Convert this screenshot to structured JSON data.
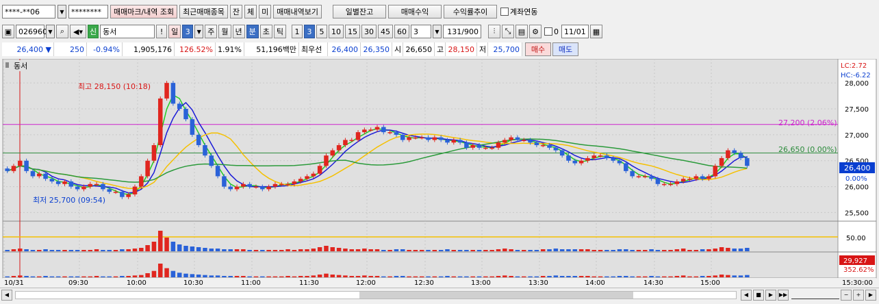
{
  "toolbar": {
    "account_no": "****-**06",
    "password": "********",
    "mark_btn": "매매마크/내역 조회",
    "recent_btn": "최근매매종목",
    "jan_btn": "잔",
    "che_btn": "체",
    "mi_btn": "미",
    "history_btn": "매매내역보기",
    "daily_btn": "일별잔고",
    "profit_btn": "매매수익",
    "rate_btn": "수익률추이",
    "link_label": "계좌연동"
  },
  "row2": {
    "code": "026960",
    "sin": "신",
    "name": "동서",
    "excl": "!",
    "il": "일",
    "il_num": "3",
    "ju": "주",
    "wol": "월",
    "nyeon": "년",
    "bun": "분",
    "cho": "초",
    "tik": "틱",
    "intervals": [
      "1",
      "3",
      "5",
      "10",
      "15",
      "30",
      "45",
      "60"
    ],
    "interval_value": "3",
    "count": "131",
    "count_max": "/900",
    "zero_label": "0",
    "date": "11/01"
  },
  "quote": {
    "price": "26,400",
    "arrow": "▼",
    "change": "250",
    "change_pct": "-0.94%",
    "volume": "1,905,176",
    "vol_ratio": "126.52%",
    "turnover": "1.91%",
    "amount": "51,196백만",
    "best_label": "최우선",
    "best_ask": "26,400",
    "best_bid": "26,350",
    "open_label": "시",
    "open": "26,650",
    "high_label": "고",
    "high": "28,150",
    "low_label": "저",
    "low": "25,700",
    "buy_btn": "매수",
    "sell_btn": "매도"
  },
  "chart_data": {
    "type": "candlestick",
    "title": "동서",
    "lc": "LC:2.72",
    "hc": "HC:-6.22",
    "yticks": [
      "28,000",
      "27,500",
      "27,000",
      "26,500",
      "26,000",
      "25,500"
    ],
    "yaxis_current": "26,400",
    "yaxis_pct": "0.00%",
    "xticks": [
      "10/31",
      "09:30",
      "10:00",
      "10:30",
      "11:00",
      "11:30",
      "12:00",
      "12:30",
      "13:00",
      "13:30",
      "14:00",
      "14:30",
      "15:00",
      "15:30:00"
    ],
    "high_note": "최고 28,150 (10:18)",
    "low_note": "최저 25,700 (09:54)",
    "line_27200": "27,200 (2.06%)",
    "line_26650": "26,650 (0.00%)",
    "vol_ref": "50.00",
    "vol_value": "29,927",
    "vol_pct": "352.62%",
    "closes": [
      26300,
      26400,
      26500,
      26300,
      26200,
      26250,
      26150,
      26100,
      26050,
      26100,
      26000,
      25950,
      26000,
      26050,
      26050,
      25950,
      25900,
      25900,
      25800,
      25850,
      26000,
      26200,
      26500,
      26800,
      27700,
      28000,
      27600,
      27500,
      27300,
      27000,
      26800,
      26600,
      26400,
      26200,
      26000,
      25950,
      26000,
      26050,
      26000,
      26000,
      25950,
      26000,
      26050,
      26050,
      26050,
      26100,
      26150,
      26200,
      26250,
      26400,
      26600,
      26700,
      26800,
      26900,
      26900,
      27050,
      27100,
      27100,
      27150,
      27050,
      27050,
      27000,
      26900,
      26950,
      26950,
      26950,
      26900,
      26950,
      26900,
      26850,
      26900,
      26850,
      26750,
      26800,
      26750,
      26750,
      26750,
      26850,
      26900,
      26950,
      26900,
      26900,
      26850,
      26800,
      26800,
      26750,
      26700,
      26600,
      26500,
      26450,
      26500,
      26550,
      26600,
      26600,
      26550,
      26500,
      26450,
      26300,
      26200,
      26200,
      26200,
      26150,
      26050,
      26050,
      26050,
      26100,
      26150,
      26150,
      26200,
      26150,
      26200,
      26400,
      26550,
      26700,
      26650,
      26550,
      26400
    ],
    "volumes": [
      2,
      3,
      4,
      3,
      2,
      2,
      3,
      2,
      2,
      2,
      2,
      2,
      2,
      2,
      3,
      2,
      2,
      2,
      3,
      3,
      4,
      5,
      9,
      14,
      30,
      20,
      14,
      10,
      8,
      7,
      6,
      5,
      4,
      4,
      3,
      3,
      3,
      3,
      2,
      2,
      2,
      2,
      2,
      2,
      3,
      2,
      3,
      3,
      4,
      6,
      8,
      6,
      5,
      4,
      3,
      3,
      4,
      3,
      3,
      2,
      2,
      3,
      3,
      2,
      2,
      2,
      2,
      2,
      2,
      3,
      2,
      2,
      2,
      2,
      2,
      2,
      2,
      3,
      4,
      3,
      2,
      2,
      2,
      2,
      3,
      3,
      4,
      3,
      3,
      3,
      3,
      3,
      2,
      2,
      2,
      2,
      3,
      3,
      2,
      2,
      2,
      3,
      2,
      2,
      2,
      3,
      4,
      2,
      2,
      3,
      3,
      4,
      6,
      5,
      4,
      4,
      5
    ]
  }
}
